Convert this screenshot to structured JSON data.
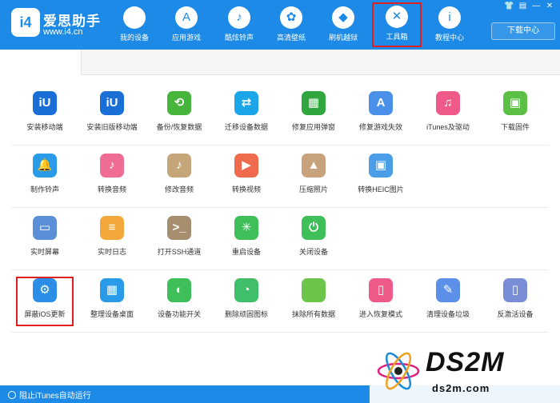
{
  "header": {
    "logo_text": "i4",
    "brand_name": "爱思助手",
    "brand_url": "www.i4.cn",
    "nav": [
      {
        "label": "我的设备",
        "icon": "apple-icon",
        "glyph": ""
      },
      {
        "label": "应用游戏",
        "icon": "app-store-icon",
        "glyph": "A"
      },
      {
        "label": "酷炫铃声",
        "icon": "bell-icon",
        "glyph": "♪"
      },
      {
        "label": "高清壁纸",
        "icon": "flower-icon",
        "glyph": "✿"
      },
      {
        "label": "刷机越狱",
        "icon": "dropbox-icon",
        "glyph": "◆"
      },
      {
        "label": "工具箱",
        "icon": "tools-icon",
        "glyph": "✕"
      },
      {
        "label": "教程中心",
        "icon": "info-icon",
        "glyph": "i"
      }
    ],
    "download_label": "下载中心",
    "window_controls": [
      "👕",
      "▤",
      "—",
      "✕"
    ]
  },
  "tools": [
    [
      {
        "label": "安装移动端",
        "color": "#1a6fd6",
        "glyph": "iU",
        "icon": "i4-app-icon"
      },
      {
        "label": "安装旧版移动端",
        "color": "#1a6fd6",
        "glyph": "iU",
        "icon": "i4-app-old-icon"
      },
      {
        "label": "备份/恢复数据",
        "color": "#47b53c",
        "glyph": "⟲",
        "icon": "backup-icon"
      },
      {
        "label": "迁移设备数据",
        "color": "#1aa6e8",
        "glyph": "⇄",
        "icon": "migrate-icon"
      },
      {
        "label": "修复应用弹窗",
        "color": "#30a63f",
        "glyph": "▦",
        "icon": "repair-popup-icon"
      },
      {
        "label": "修复游戏失效",
        "color": "#4a8fe8",
        "glyph": "A",
        "icon": "repair-game-icon"
      },
      {
        "label": "iTunes及驱动",
        "color": "#ef5a88",
        "glyph": "♫",
        "icon": "itunes-icon"
      },
      {
        "label": "下载固件",
        "color": "#5cbf46",
        "glyph": "▣",
        "icon": "firmware-icon"
      }
    ],
    [
      {
        "label": "制作铃声",
        "color": "#2a9be8",
        "glyph": "🔔",
        "icon": "ringtone-icon"
      },
      {
        "label": "转换音频",
        "color": "#ef6d94",
        "glyph": "♪",
        "icon": "audio-convert-icon"
      },
      {
        "label": "修改音频",
        "color": "#c5a57a",
        "glyph": "♪",
        "icon": "audio-edit-icon"
      },
      {
        "label": "转换视频",
        "color": "#f06b4d",
        "glyph": "▶",
        "icon": "video-convert-icon"
      },
      {
        "label": "压缩照片",
        "color": "#c7a27c",
        "glyph": "▲",
        "icon": "photo-compress-icon"
      },
      {
        "label": "转换HEIC图片",
        "color": "#4a9de6",
        "glyph": "▣",
        "icon": "heic-icon"
      }
    ],
    [
      {
        "label": "实时屏幕",
        "color": "#5b8fd8",
        "glyph": "▭",
        "icon": "screen-icon"
      },
      {
        "label": "实时日志",
        "color": "#f2a83a",
        "glyph": "≡",
        "icon": "log-icon"
      },
      {
        "label": "打开SSH通道",
        "color": "#a58d6e",
        "glyph": ">_",
        "icon": "ssh-icon"
      },
      {
        "label": "重启设备",
        "color": "#3fbf5a",
        "glyph": "✳",
        "icon": "reboot-icon"
      },
      {
        "label": "关闭设备",
        "color": "#3fbf5a",
        "glyph": "⏻",
        "icon": "shutdown-icon"
      }
    ],
    [
      {
        "label": "屏蔽iOS更新",
        "color": "#2a8ee6",
        "glyph": "⚙",
        "icon": "block-update-icon",
        "highlight": true
      },
      {
        "label": "整理设备桌面",
        "color": "#2a9be8",
        "glyph": "▦",
        "icon": "desktop-organize-icon"
      },
      {
        "label": "设备功能开关",
        "color": "#3fbf5a",
        "glyph": "◐",
        "icon": "switch-icon"
      },
      {
        "label": "删除顽固图标",
        "color": "#3fbf6a",
        "glyph": "◔",
        "icon": "delete-icon"
      },
      {
        "label": "抹除所有数据",
        "color": "#6cc44b",
        "glyph": "",
        "icon": "erase-icon"
      },
      {
        "label": "进入恢复模式",
        "color": "#ef5a88",
        "glyph": "▯",
        "icon": "recovery-icon"
      },
      {
        "label": "清理设备垃圾",
        "color": "#5b8fe8",
        "glyph": "✎",
        "icon": "clean-icon"
      },
      {
        "label": "反激活设备",
        "color": "#7a8ed8",
        "glyph": "▯",
        "icon": "deactivate-icon"
      }
    ]
  ],
  "footer": {
    "status": "阻止iTunes自动运行"
  },
  "watermark": {
    "main": "DS2M",
    "sub": "ds2m.com"
  }
}
